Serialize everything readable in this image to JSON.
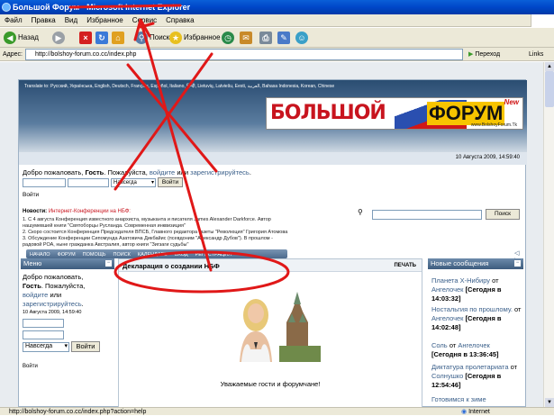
{
  "window": {
    "title": "Большой Форум - Microsoft Internet Explorer"
  },
  "menu": [
    "Файл",
    "Правка",
    "Вид",
    "Избранное",
    "Сервис",
    "Справка"
  ],
  "toolbar": {
    "back": "Назад",
    "search": "Поиск",
    "favorites": "Избранное"
  },
  "address": {
    "label": "Адрес:",
    "url": "http://bolshoy-forum.co.cc/index.php",
    "go": "Переход",
    "links": "Links"
  },
  "forum": {
    "translate": "Translate to: Русский, Українська, English, Deutsch, Français, Español, Italiano, हिन्दी, Lietuvių, Latviešu, Eesti, العربية, Bahasa Indonesia, Korean, Chinese",
    "logo_left": "БОЛЬШОЙ",
    "logo_right": "ФОРУМ",
    "logo_new": "New",
    "logo_url": "www.BolshoyForum.Tk",
    "date": "10 Августа 2009, 14:59:40",
    "welcome_prefix": "Добро пожаловать, ",
    "welcome_guest": "Гость",
    "welcome_mid": ". Пожалуйста, ",
    "welcome_login": "войдите",
    "welcome_or": " или ",
    "welcome_register": "зарегистрируйтесь",
    "welcome_end": ".",
    "session_option": "Навсегда",
    "login_button": "Войти",
    "login_label": "Войти",
    "search_button": "Поиск",
    "news_label": "Новости:",
    "news_headline": "Интернет-Конференции на НБФ:",
    "news": [
      "1. С 4 августа Конференция известного анархиста, музыканта и писателя James Alexander Darkforce. Автор",
      "нашумевшей книги \"Святоборцы Русланда. Современная инквизиция\"",
      "2. Скоро состоится Конференция Председателя ВПСБ, Главного редактора газеты \"Революция\" Григория Атомова",
      "3. Обсуждение Конференции Сипомунда Азатовича Дикбайис (псевдоним \"Александр Дубов\"). В прошлом -",
      "радовой РОА, ныне гражданка Австралия, автор книги \"Зигзаги судьбы\""
    ],
    "nav": [
      "НАЧАЛО",
      "ФОРУМ",
      "ПОМОЩЬ",
      "ПОИСК",
      "КАЛЕНДАРЬ",
      "ВХОД",
      "РЕГИСТРАЦИЯ"
    ],
    "left_panel": {
      "title": "Меню",
      "welcome_prefix": "Добро пожаловать,",
      "guest": "Гость",
      "please": ". Пожалуйста,",
      "login": "войдите",
      "or": " или",
      "register": "зарегистрируйтесь",
      "end": ".",
      "date": "10 Августа 2009, 14:59:40",
      "option": "Навсегда",
      "button": "Войти",
      "footer": "Войти"
    },
    "center": {
      "title": "Декларация о создании НБФ",
      "print": "ПЕЧАТЬ",
      "greeting": "Уважаемые гости и форумчане!"
    },
    "right_panel": {
      "title": "Новые сообщения",
      "posts": [
        {
          "topic": "Планета X-Нибиру",
          "by": "от",
          "author": "Ангелочек",
          "time": "[Сегодня в 14:03:32]"
        },
        {
          "topic": "Ностальгия по прошлому.",
          "by": "от",
          "author": "Ангелочек",
          "time": "[Сегодня в 14:02:48]"
        },
        {
          "topic": "Соль",
          "by": "от",
          "author": "Ангелочек",
          "time": "[Сегодня в 13:36:45]"
        },
        {
          "topic": "Диктатура пролетариата",
          "by": "от",
          "author": "Солнушко",
          "time": "[Сегодня в 12:54:46]"
        },
        {
          "topic": "Готовимся к зиме",
          "by": "",
          "author": "",
          "time": ""
        }
      ]
    }
  },
  "status": {
    "url": "http://bolshoy-forum.co.cc/index.php?action=help",
    "zone": "Internet"
  }
}
